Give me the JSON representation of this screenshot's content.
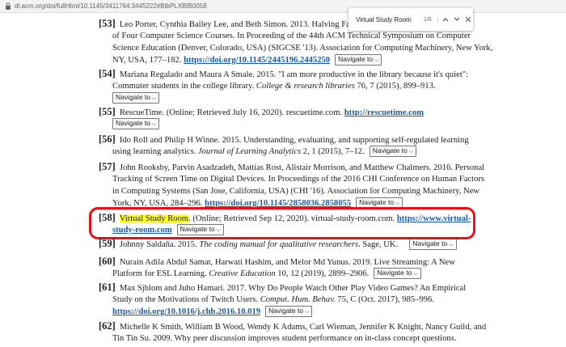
{
  "browser": {
    "url": "dl.acm.org/doi/fullHtml/10.1145/3411764.3445222#BibPLXBIB0058",
    "lock_icon": "lock-icon"
  },
  "find_bar": {
    "query": "Virtual Study Room",
    "count": "1/6",
    "icons": [
      "chevron-up-icon",
      "chevron-down-icon",
      "close-icon"
    ]
  },
  "nav_label": "Navigate to",
  "highlight_color": "#ffff22",
  "circle_color": "#e8101b",
  "link_color": "#1a5aa8",
  "references": [
    {
      "num": "[53]",
      "lines": [
        "Leo Porter, Cynthia Bailey Lee, and Beth Simon. 2013. Halving Fail R",
        "of Four Computer Science Courses. In Proceeding of the 44th ACM Technical Symposium on Computer",
        "Science Education (Denver, Colorado, USA) (SIGCSE '13). Association for Computing Machinery, New York,",
        "NY, USA, 177–182."
      ],
      "doi": "https://doi.org/10.1145/2445196.2445250"
    },
    {
      "num": "[54]",
      "lines": [
        "Mariana Regalado and Maura A Smale. 2015. \"I am more productive in the library because it's quiet\":",
        "Commuter students in the college library."
      ],
      "journal": "College & research libraries",
      "rest": "76, 7 (2015), 899–913."
    },
    {
      "num": "[55]",
      "lines": [
        "RescueTime. (Online; Retrieved July 16, 2020). rescuetime.com."
      ],
      "doi": "http://rescuetime.com"
    },
    {
      "num": "[56]",
      "lines": [
        "Ido Roll and Philip H Winne. 2015. Understanding, evaluating, and supporting self-regulated learning",
        "using learning analytics."
      ],
      "journal": "Journal of Learning Analytics",
      "rest": "2, 1 (2015), 7–12."
    },
    {
      "num": "[57]",
      "lines": [
        "John Rooksby, Parvin Asadzadeh, Mattias Rost, Alistair Morrison, and Matthew Chalmers. 2016. Personal",
        "Tracking of Screen Time on Digital Devices. In Proceedings of the 2016 CHI Conference on Human Factors",
        "in Computing Systems (San Jose, California, USA) (CHI '16). Association for Computing Machinery, New",
        "York, NY, USA, 284–296."
      ],
      "doi": "https://doi.org/10.1145/2858036.2858055"
    },
    {
      "num": "[58]",
      "highlight": "Virtual Study Room",
      "rest": ". (Online; Retrieved Sep 12, 2020). virtual-study-room.com.",
      "doi_a": "https://www.virtual-",
      "doi_b": "study-room.com"
    },
    {
      "num": "[59]",
      "before": "Johnny Saldaña. 2015.",
      "journal": "The coding manual for qualitative researchers",
      "rest": ". Sage, UK."
    },
    {
      "num": "[60]",
      "lines": [
        "Nurain Adila Abdul Samat, Harwati Hashim, and Melor Md Yunus. 2019. Live Streaming: A New",
        "Platform for ESL Learning."
      ],
      "journal": "Creative Education",
      "rest": "10, 12 (2019), 2899–2906."
    },
    {
      "num": "[61]",
      "lines": [
        "Max Sjblom and Juho Hamari. 2017. Why Do People Watch Other Play Video Games? An Empirical",
        "Study on the Motivations of Twitch Users."
      ],
      "journal": "Comput. Hum. Behav.",
      "rest": "75, C (Oct. 2017), 985–996.",
      "doi": "https://doi.org/10.1016/j.chb.2016.10.019"
    },
    {
      "num": "[62]",
      "lines": [
        "Michelle K Smith, William B Wood, Wendy K Adams, Carl Wieman, Jennifer K Knight, Nancy Guild, and",
        "Tin Tin Su. 2009. Why peer discussion improves student performance on in-class concept questions."
      ]
    }
  ]
}
